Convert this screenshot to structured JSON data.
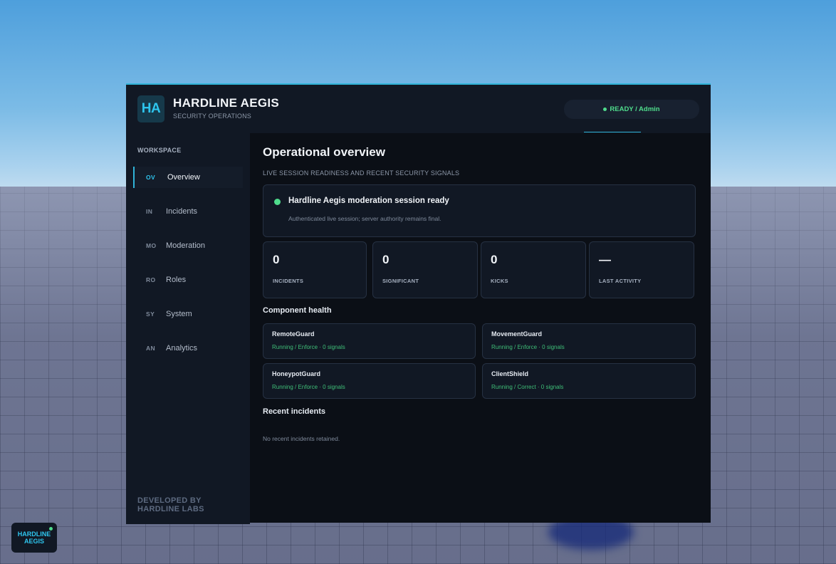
{
  "header": {
    "logo_text": "HA",
    "title": "HARDLINE AEGIS",
    "subtitle": "SECURITY OPERATIONS",
    "status": "READY / Admin"
  },
  "sidebar": {
    "heading": "WORKSPACE",
    "items": [
      {
        "code": "OV",
        "label": "Overview",
        "active": true
      },
      {
        "code": "IN",
        "label": "Incidents",
        "active": false
      },
      {
        "code": "MO",
        "label": "Moderation",
        "active": false
      },
      {
        "code": "RO",
        "label": "Roles",
        "active": false
      },
      {
        "code": "SY",
        "label": "System",
        "active": false
      },
      {
        "code": "AN",
        "label": "Analytics",
        "active": false
      }
    ],
    "footer_line1": "DEVELOPED BY",
    "footer_line2": "HARDLINE LABS"
  },
  "main": {
    "title": "Operational overview",
    "subtitle": "LIVE SESSION READINESS AND RECENT SECURITY SIGNALS",
    "banner": {
      "title": "Hardline Aegis moderation session ready",
      "text": "Authenticated live session; server authority remains final."
    },
    "stats": [
      {
        "value": "0",
        "label": "INCIDENTS"
      },
      {
        "value": "0",
        "label": "SIGNIFICANT"
      },
      {
        "value": "0",
        "label": "KICKS"
      },
      {
        "value": "—",
        "label": "LAST ACTIVITY"
      }
    ],
    "component_health_title": "Component health",
    "components": [
      {
        "name": "RemoteGuard",
        "status": "Running / Enforce · 0 signals"
      },
      {
        "name": "MovementGuard",
        "status": "Running / Enforce · 0 signals"
      },
      {
        "name": "HoneypotGuard",
        "status": "Running / Enforce · 0 signals"
      },
      {
        "name": "ClientShield",
        "status": "Running / Correct · 0 signals"
      }
    ],
    "recent_incidents_title": "Recent incidents",
    "recent_incidents_empty": "No recent incidents retained."
  },
  "launcher": {
    "line1": "HARDLINE",
    "line2": "AEGIS"
  },
  "colors": {
    "accent": "#2fb3d8",
    "ok": "#4fdc8c",
    "panel": "#111824",
    "background": "#0b0f16"
  }
}
